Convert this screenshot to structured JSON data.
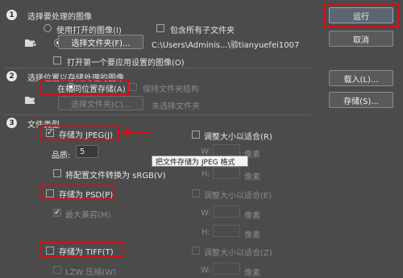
{
  "section1": {
    "number": "1",
    "title": "选择要处理的图像",
    "use_open_images": "使用打开的图像(I)",
    "include_subfolders": "包含所有子文件夹",
    "select_folder_button": "选择文件夹(F)...",
    "folder_path": "C:\\Users\\Adminis...\\验tianyuefei1007",
    "open_first_image": "打开第一个要应用设置的图像(O)"
  },
  "section2": {
    "number": "2",
    "title": "选择位置以存储处理的图像",
    "save_same_location": "在相同位置存储(A)",
    "keep_folder_structure": "保持文件夹结构",
    "select_folder_button": "选择文件夹(C)...",
    "no_folder_selected": "未选择文件夹"
  },
  "section3": {
    "number": "3",
    "title": "文件类型",
    "save_jpeg": "存储为 JPEG(J)",
    "resize_to_fit_r": "调整大小以适合(R)",
    "quality_label": "品质:",
    "quality_value": "5",
    "w_label": "W:",
    "h_label": "H:",
    "px_label": "像素",
    "tooltip": "把文件存储为 JPEG 格式",
    "convert_srgb": "将配置文件转换为 sRGB(V)",
    "save_psd": "存储为 PSD(P)",
    "resize_to_fit_e": "调整大小以适合(E)",
    "max_compat": "最大兼容(M)",
    "save_tiff": "存储为 TIFF(T)",
    "resize_to_fit_z": "调整大小以适合(Z)",
    "lzw": "LZW 压缩(W)"
  },
  "buttons": {
    "run": "运行",
    "cancel": "取消",
    "load": "载入(L)...",
    "save": "存储(S)..."
  },
  "colors": {
    "background": "#4b4b4b",
    "highlight_red": "#d0111b"
  }
}
